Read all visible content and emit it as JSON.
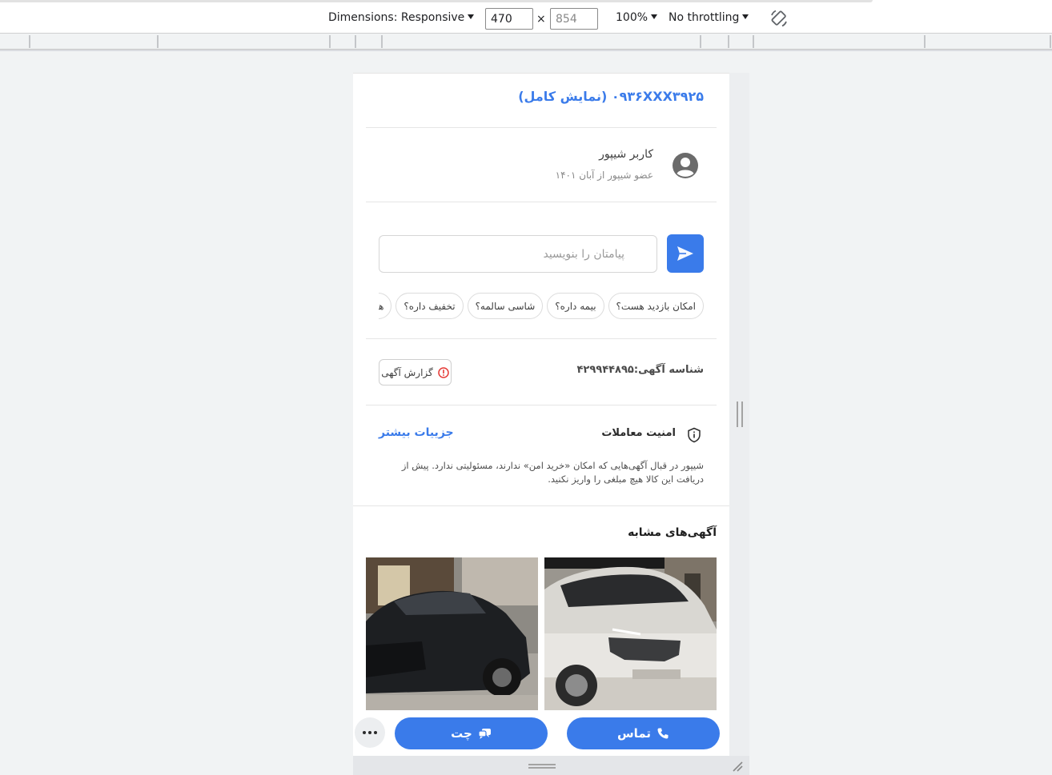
{
  "devtools": {
    "dimensions_label": "Dimensions: Responsive",
    "width_value": "470",
    "height_value": "854",
    "times_sign": "×",
    "zoom_label": "100%",
    "throttling_label": "No throttling",
    "icons": {
      "rotate": "rotate-icon",
      "caret": "caret-down-icon"
    }
  },
  "page": {
    "phone": {
      "text": "۰۹۳۶XXX۳۹۲۵ (نمایش کامل)",
      "color": "#3a7bea"
    },
    "user": {
      "name": "کاربر شیپور",
      "member_since": "عضو شیپور از آبان ۱۴۰۱",
      "icon": "user-circle-icon"
    },
    "message": {
      "placeholder": "پیامتان را بنویسید",
      "value": "",
      "send_icon": "send-icon"
    },
    "quick_replies": [
      "امکان بازدید هست؟",
      "بیمه داره؟",
      "شاسی سالمه؟",
      "تخفیف داره؟",
      "هنوز موجوده؟"
    ],
    "ad_id": "شناسه آگهی:۴۲۹۹۴۴۸۹۵",
    "report": {
      "label": "گزارش آگهی",
      "icon": "alert-circle-icon",
      "icon_color": "#e53935"
    },
    "security": {
      "title": "امنیت معاملات",
      "more_link": "جزییات بیشتر",
      "text": "شیپور در قبال آگهی‌هایی که امکان «خرید امن» ندارند، مسئولیتی ندارد. پیش از دریافت این کالا هیچ مبلغی را واریز نکنید.",
      "icon": "shield-info-icon"
    },
    "similar": {
      "title": "آگهی‌های مشابه",
      "cards": [
        {
          "image": "white-suv-photo",
          "color": "#e8e6e2"
        },
        {
          "image": "black-suv-photo",
          "color": "#1d1f22"
        }
      ]
    },
    "actions": {
      "call_label": "تماس",
      "call_icon": "phone-icon",
      "chat_label": "چت",
      "chat_icon": "chat-bubbles-icon",
      "more_icon": "more-dots-icon"
    },
    "accent_color": "#3a7bea"
  }
}
